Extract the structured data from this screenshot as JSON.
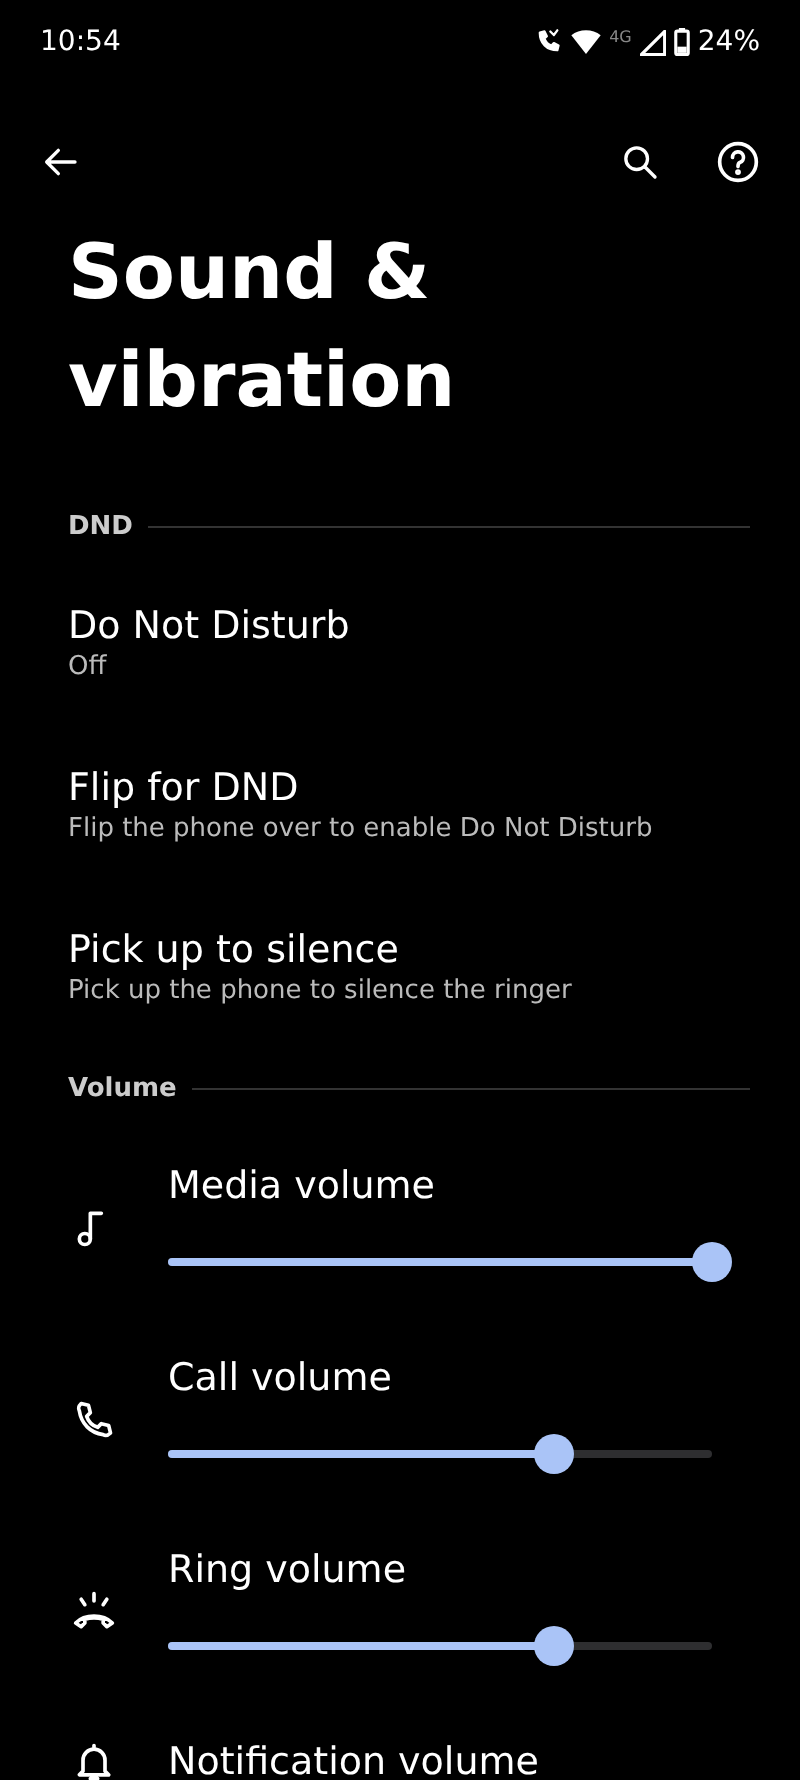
{
  "status_bar": {
    "time": "10:54",
    "network": "4G",
    "battery": "24%"
  },
  "title": "Sound & vibration",
  "sections": [
    {
      "header": "DND",
      "items": [
        {
          "title": "Do Not Disturb",
          "summary": "Off"
        },
        {
          "title": "Flip for DND",
          "summary": "Flip the phone over to enable Do Not Disturb"
        },
        {
          "title": "Pick up to silence",
          "summary": "Pick up the phone to silence the ringer"
        }
      ]
    },
    {
      "header": "Volume",
      "sliders": [
        {
          "label": "Media volume",
          "level": 1.0
        },
        {
          "label": "Call volume",
          "level": 0.71
        },
        {
          "label": "Ring volume",
          "level": 0.71
        },
        {
          "label": "Notification volume"
        }
      ]
    }
  ]
}
